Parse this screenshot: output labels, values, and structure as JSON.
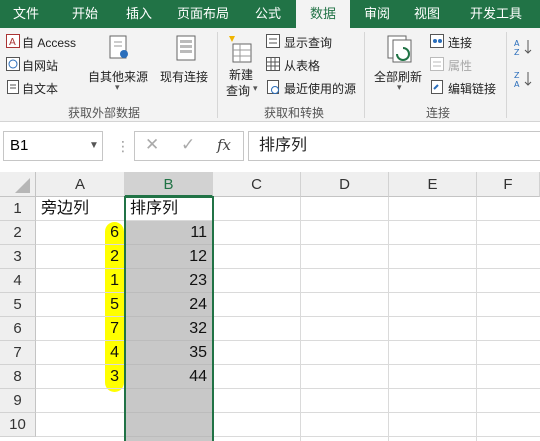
{
  "tabs": [
    "文件",
    "开始",
    "插入",
    "页面布局",
    "公式",
    "数据",
    "审阅",
    "视图",
    "开发工具"
  ],
  "active_tab": "数据",
  "ribbon": {
    "get_external": {
      "access": "自 Access",
      "web": "自网站",
      "text": "自文本",
      "other": "自其他来源",
      "existing": "现有连接",
      "group_label": "获取外部数据"
    },
    "get_transform": {
      "new_query_1": "新建",
      "new_query_2": "查询",
      "show_queries": "显示查询",
      "from_table": "从表格",
      "recent_sources": "最近使用的源",
      "group_label": "获取和转换"
    },
    "connections": {
      "refresh_all": "全部刷新",
      "connections": "连接",
      "properties": "属性",
      "edit_links": "编辑链接",
      "group_label": "连接"
    }
  },
  "name_box": "B1",
  "formula_bar": "排序列",
  "columns": [
    "A",
    "B",
    "C",
    "D",
    "E",
    "F"
  ],
  "selected_column": "B",
  "rows": [
    "1",
    "2",
    "3",
    "4",
    "5",
    "6",
    "7",
    "8",
    "9",
    "10"
  ],
  "cells": {
    "A": [
      "旁边列",
      "6",
      "2",
      "1",
      "5",
      "7",
      "4",
      "3",
      "",
      ""
    ],
    "B": [
      "排序列",
      "11",
      "12",
      "23",
      "24",
      "32",
      "35",
      "44",
      "",
      ""
    ]
  },
  "colors": {
    "excel_green": "#217346",
    "highlight": "#ffff00",
    "selection_fill": "#c8c8c8"
  }
}
